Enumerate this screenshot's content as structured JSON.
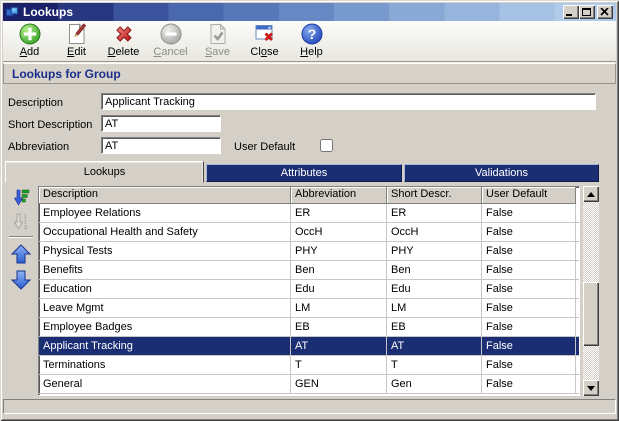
{
  "window": {
    "title": "Lookups",
    "controls": [
      {
        "id": "minimize",
        "icon": "minimize-icon"
      },
      {
        "id": "maximize",
        "icon": "maximize-icon"
      },
      {
        "id": "close",
        "icon": "close-icon"
      }
    ]
  },
  "toolbar": {
    "buttons": [
      {
        "id": "add",
        "label": "Add",
        "accel": 0,
        "disabled": false,
        "icon": "add-icon"
      },
      {
        "id": "edit",
        "label": "Edit",
        "accel": 0,
        "disabled": false,
        "icon": "edit-icon"
      },
      {
        "id": "delete",
        "label": "Delete",
        "accel": 0,
        "disabled": false,
        "icon": "delete-icon"
      },
      {
        "id": "cancel",
        "label": "Cancel",
        "accel": 0,
        "disabled": true,
        "icon": "cancel-icon"
      },
      {
        "id": "save",
        "label": "Save",
        "accel": 0,
        "disabled": true,
        "icon": "save-icon"
      },
      {
        "id": "close",
        "label": "Close",
        "accel": 2,
        "disabled": false,
        "icon": "close-window-icon"
      },
      {
        "id": "help",
        "label": "Help",
        "accel": 0,
        "disabled": false,
        "icon": "help-icon"
      }
    ]
  },
  "group_header": {
    "title": "Lookups for Group"
  },
  "form": {
    "description": {
      "label": "Description",
      "value": "Applicant Tracking"
    },
    "short_description": {
      "label": "Short Description",
      "value": "AT"
    },
    "abbreviation": {
      "label": "Abbreviation",
      "value": "AT"
    },
    "user_default": {
      "label": "User Default",
      "checked": false
    }
  },
  "tabs": [
    {
      "label": "Lookups",
      "active": true
    },
    {
      "label": "Attributes",
      "active": false
    },
    {
      "label": "Validations",
      "active": false
    }
  ],
  "side_buttons": [
    {
      "id": "sort",
      "icon": "sort-descending-icon",
      "disabled": false
    },
    {
      "id": "sort-numeric",
      "icon": "sort-numeric-icon",
      "disabled": true
    },
    {
      "id": "move-up",
      "icon": "arrow-up-icon",
      "disabled": false
    },
    {
      "id": "move-down",
      "icon": "arrow-down-icon",
      "disabled": false
    }
  ],
  "table": {
    "columns": [
      "Description",
      "Abbreviation",
      "Short Descr.",
      "User Default"
    ],
    "rows": [
      {
        "description": "Employee Relations",
        "abbreviation": "ER",
        "short_descr": "ER",
        "user_default": "False",
        "selected": false
      },
      {
        "description": "Occupational Health and Safety",
        "abbreviation": "OccH",
        "short_descr": "OccH",
        "user_default": "False",
        "selected": false
      },
      {
        "description": "Physical Tests",
        "abbreviation": "PHY",
        "short_descr": "PHY",
        "user_default": "False",
        "selected": false
      },
      {
        "description": "Benefits",
        "abbreviation": "Ben",
        "short_descr": "Ben",
        "user_default": "False",
        "selected": false
      },
      {
        "description": "Education",
        "abbreviation": "Edu",
        "short_descr": "Edu",
        "user_default": "False",
        "selected": false
      },
      {
        "description": "Leave Mgmt",
        "abbreviation": "LM",
        "short_descr": "LM",
        "user_default": "False",
        "selected": false
      },
      {
        "description": "Employee Badges",
        "abbreviation": "EB",
        "short_descr": "EB",
        "user_default": "False",
        "selected": false
      },
      {
        "description": "Applicant Tracking",
        "abbreviation": "AT",
        "short_descr": "AT",
        "user_default": "False",
        "selected": true
      },
      {
        "description": "Terminations",
        "abbreviation": "T",
        "short_descr": "T",
        "user_default": "False",
        "selected": false
      },
      {
        "description": "General",
        "abbreviation": "GEN",
        "short_descr": "Gen",
        "user_default": "False",
        "selected": false
      }
    ]
  },
  "colors": {
    "accent_navy": "#1B2E74",
    "selection_bg": "#1B2E74",
    "selection_text": "#FFFFFF",
    "window_face": "#D4D0C8",
    "header_text": "#1B2E8C"
  }
}
